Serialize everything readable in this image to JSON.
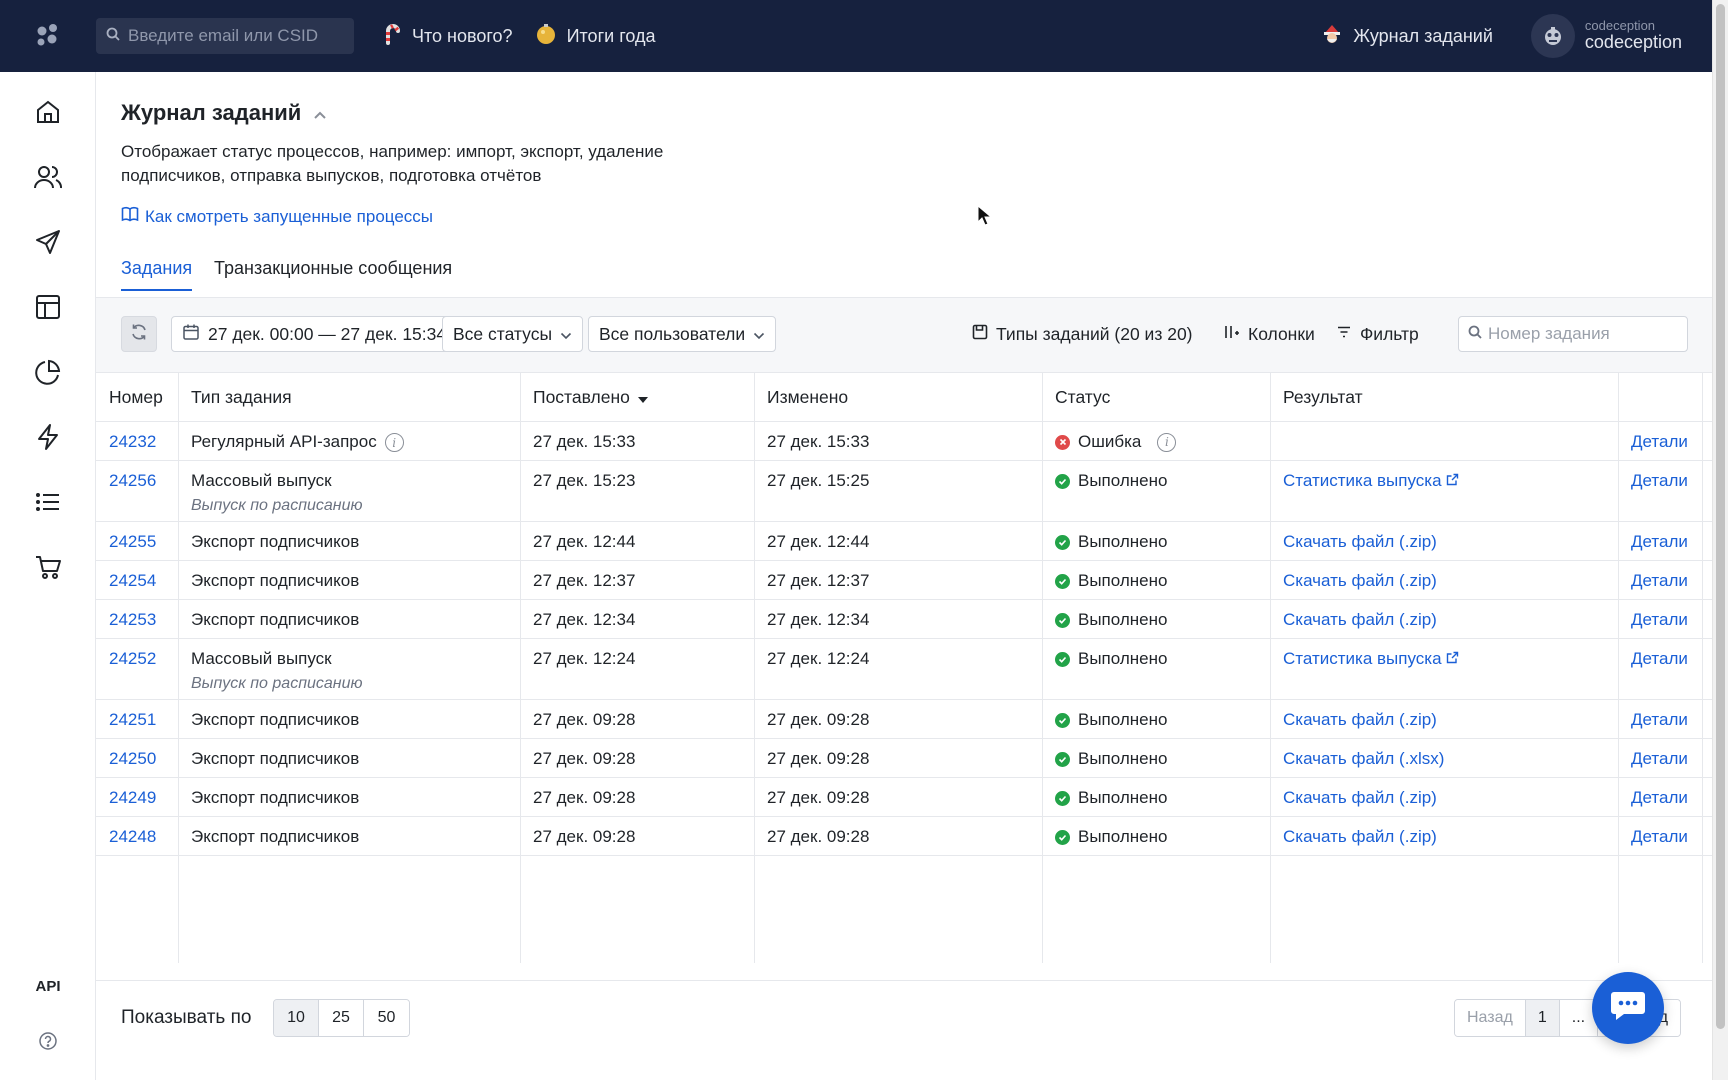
{
  "topbar": {
    "search_placeholder": "Введите email или CSID",
    "whats_new": "Что нового?",
    "year_results": "Итоги года",
    "task_log": "Журнал заданий",
    "user_small": "codeception",
    "user_big": "codeception"
  },
  "sidebar": {
    "api_label": "API",
    "icons": [
      "home-icon",
      "users-icon",
      "send-icon",
      "layout-icon",
      "pie-chart-icon",
      "lightning-icon",
      "list-icon",
      "cart-icon",
      "help-icon"
    ]
  },
  "page": {
    "title": "Журнал заданий",
    "description": "Отображает статус процессов, например: импорт, экспорт, удаление подписчиков, отправка выпусков, подготовка отчётов",
    "help_link": "Как смотреть запущенные процессы"
  },
  "tabs": [
    {
      "label": "Задания",
      "active": true
    },
    {
      "label": "Транзакционные сообщения",
      "active": false
    }
  ],
  "toolbar": {
    "date_range": "27 дек. 00:00 — 27 дек. 15:34",
    "status_filter": "Все статусы",
    "user_filter": "Все пользователи",
    "task_types": "Типы заданий (20 из 20)",
    "columns": "Колонки",
    "filter": "Фильтр",
    "search_placeholder": "Номер задания"
  },
  "table": {
    "columns": [
      "Номер",
      "Тип задания",
      "Поставлено",
      "Изменено",
      "Статус",
      "Результат",
      ""
    ],
    "details_label": "Детали",
    "rows": [
      {
        "id": "24232",
        "type": "Регулярный API-запрос",
        "sub": "",
        "placed": "27 дек. 15:33",
        "changed": "27 дек. 15:33",
        "status": "Ошибка",
        "status_kind": "error",
        "result": "",
        "result_ext": false
      },
      {
        "id": "24256",
        "type": "Массовый выпуск",
        "sub": "Выпуск по расписанию",
        "placed": "27 дек. 15:23",
        "changed": "27 дек. 15:25",
        "status": "Выполнено",
        "status_kind": "ok",
        "result": "Статистика выпуска",
        "result_ext": true
      },
      {
        "id": "24255",
        "type": "Экспорт подписчиков",
        "sub": "",
        "placed": "27 дек. 12:44",
        "changed": "27 дек. 12:44",
        "status": "Выполнено",
        "status_kind": "ok",
        "result": "Скачать файл (.zip)",
        "result_ext": false
      },
      {
        "id": "24254",
        "type": "Экспорт подписчиков",
        "sub": "",
        "placed": "27 дек. 12:37",
        "changed": "27 дек. 12:37",
        "status": "Выполнено",
        "status_kind": "ok",
        "result": "Скачать файл (.zip)",
        "result_ext": false
      },
      {
        "id": "24253",
        "type": "Экспорт подписчиков",
        "sub": "",
        "placed": "27 дек. 12:34",
        "changed": "27 дек. 12:34",
        "status": "Выполнено",
        "status_kind": "ok",
        "result": "Скачать файл (.zip)",
        "result_ext": false
      },
      {
        "id": "24252",
        "type": "Массовый выпуск",
        "sub": "Выпуск по расписанию",
        "placed": "27 дек. 12:24",
        "changed": "27 дек. 12:24",
        "status": "Выполнено",
        "status_kind": "ok",
        "result": "Статистика выпуска",
        "result_ext": true
      },
      {
        "id": "24251",
        "type": "Экспорт подписчиков",
        "sub": "",
        "placed": "27 дек. 09:28",
        "changed": "27 дек. 09:28",
        "status": "Выполнено",
        "status_kind": "ok",
        "result": "Скачать файл (.zip)",
        "result_ext": false
      },
      {
        "id": "24250",
        "type": "Экспорт подписчиков",
        "sub": "",
        "placed": "27 дек. 09:28",
        "changed": "27 дек. 09:28",
        "status": "Выполнено",
        "status_kind": "ok",
        "result": "Скачать файл (.xlsx)",
        "result_ext": false
      },
      {
        "id": "24249",
        "type": "Экспорт подписчиков",
        "sub": "",
        "placed": "27 дек. 09:28",
        "changed": "27 дек. 09:28",
        "status": "Выполнено",
        "status_kind": "ok",
        "result": "Скачать файл (.zip)",
        "result_ext": false
      },
      {
        "id": "24248",
        "type": "Экспорт подписчиков",
        "sub": "",
        "placed": "27 дек. 09:28",
        "changed": "27 дек. 09:28",
        "status": "Выполнено",
        "status_kind": "ok",
        "result": "Скачать файл (.zip)",
        "result_ext": false
      }
    ]
  },
  "footer": {
    "per_page_label": "Показывать по",
    "per_page_options": [
      "10",
      "25",
      "50"
    ],
    "prev": "Назад",
    "page": "1",
    "ellipsis": "...",
    "next_partial": "ед"
  },
  "colors": {
    "topbar_bg": "#16213e",
    "accent": "#1a5fd6",
    "ok": "#22a348",
    "error": "#e04a4a"
  }
}
